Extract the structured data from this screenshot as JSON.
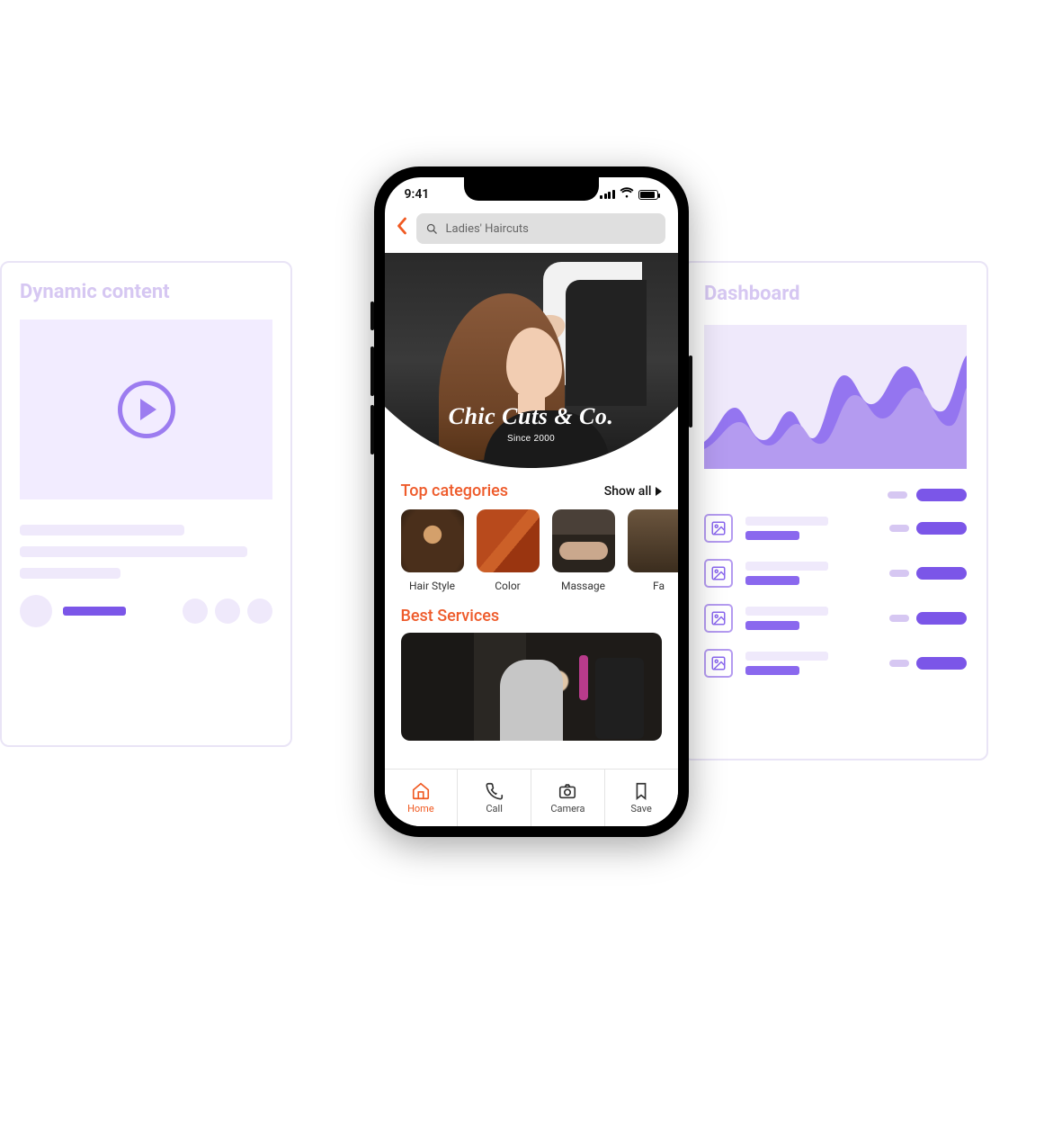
{
  "left_card": {
    "title": "Dynamic content"
  },
  "right_card": {
    "title": "Dashboard"
  },
  "phone": {
    "status": {
      "time": "9:41"
    },
    "search": {
      "placeholder": "Ladies' Haircuts"
    },
    "hero": {
      "brand": "Chic Cuts & Co.",
      "since": "Since 2000"
    },
    "top_categories": {
      "title": "Top categories",
      "showall": "Show all",
      "items": [
        {
          "label": "Hair Style"
        },
        {
          "label": "Color"
        },
        {
          "label": "Massage"
        },
        {
          "label": "Fa"
        }
      ]
    },
    "best_services": {
      "title": "Best Services"
    },
    "tabs": [
      {
        "label": "Home",
        "active": true
      },
      {
        "label": "Call",
        "active": false
      },
      {
        "label": "Camera",
        "active": false
      },
      {
        "label": "Save",
        "active": false
      }
    ]
  },
  "colors": {
    "accent_orange": "#f05a22",
    "accent_purple": "#7b56e8",
    "purple_light": "#efe9fb"
  }
}
